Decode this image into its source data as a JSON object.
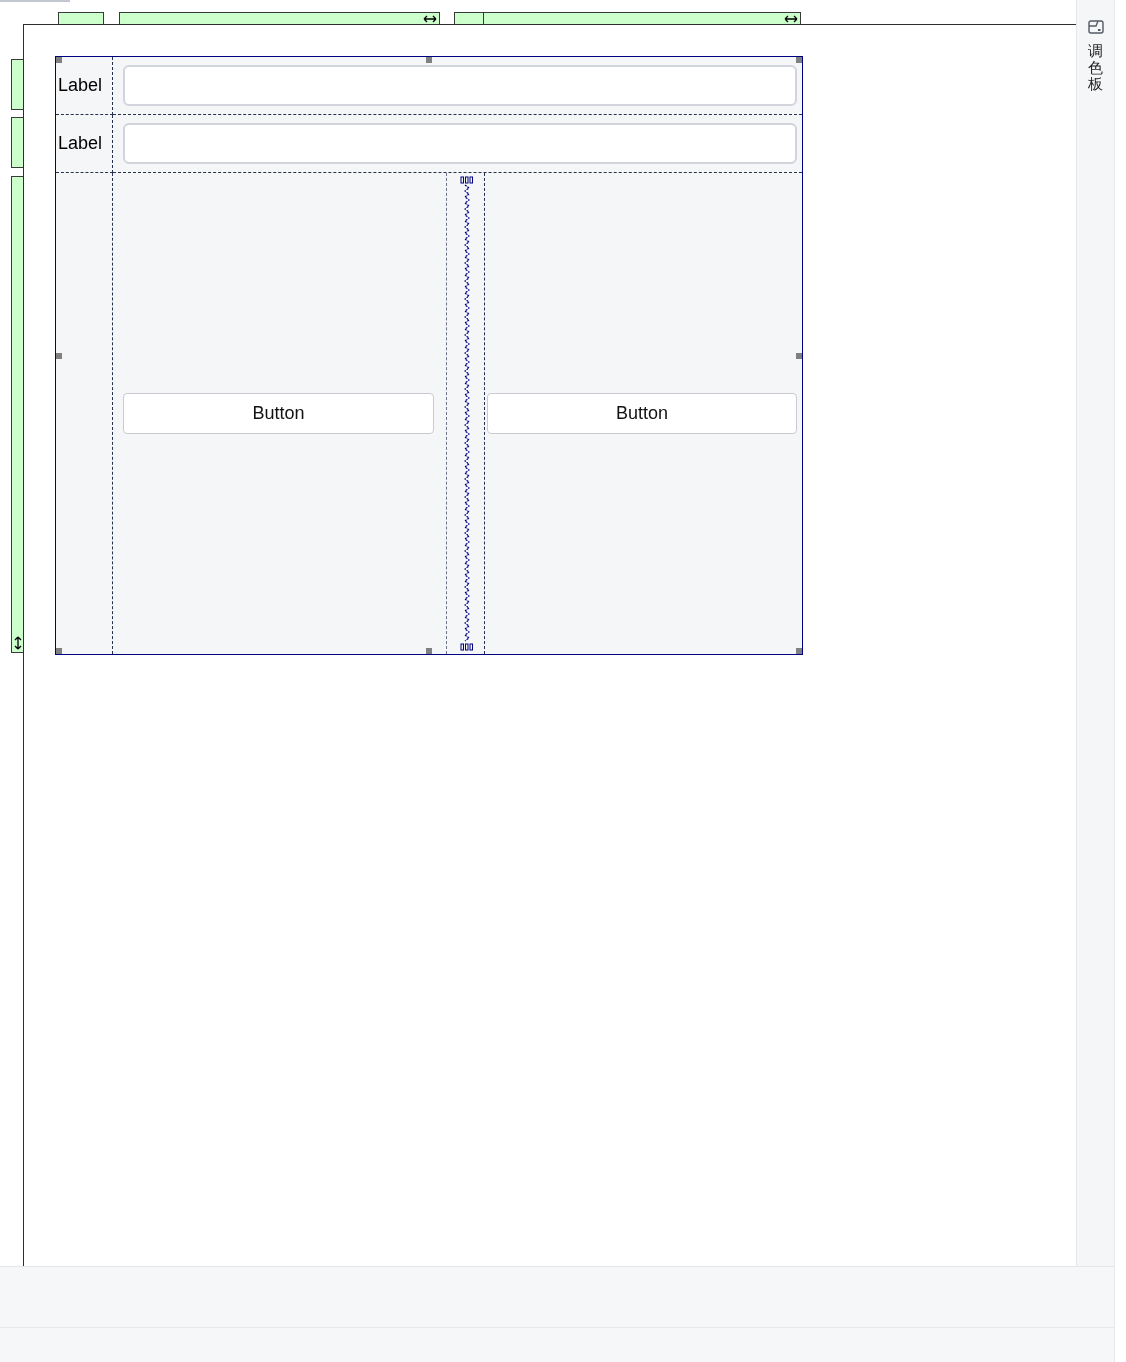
{
  "layout_markers": {
    "columns": [
      {
        "stretch": false
      },
      {
        "stretch": true
      },
      {
        "stretch": false
      },
      {
        "stretch": true
      }
    ],
    "rows": [
      {
        "stretch": false
      },
      {
        "stretch": false
      },
      {
        "stretch": true
      }
    ]
  },
  "form": {
    "selected": true,
    "rows": [
      {
        "label": "Label"
      },
      {
        "label": "Label"
      }
    ],
    "buttons": [
      {
        "label": "Button"
      },
      {
        "label": "Button"
      }
    ]
  },
  "dock": {
    "title": "调色板"
  }
}
